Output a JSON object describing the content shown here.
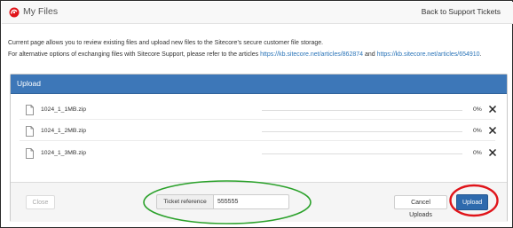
{
  "header": {
    "title": "My Files",
    "back_link": "Back to Support Tickets",
    "logo_icon": "sitecore-logo-icon"
  },
  "intro": {
    "line1": "Current page allows you to review existing files and upload new files to the Sitecore’s secure customer file storage.",
    "line2_prefix": "For alternative options of exchanging files with Sitecore Support, please refer to the articles",
    "link1": "https://kb.sitecore.net/articles/862874",
    "and": "and",
    "link2": "https://kb.sitecore.net/articles/654910",
    "suffix": "."
  },
  "upload_panel": {
    "title": "Upload",
    "files": [
      {
        "name": "1024_1_1MB.zip",
        "progress": 0,
        "percent_label": "0%"
      },
      {
        "name": "1024_1_2MB.zip",
        "progress": 0,
        "percent_label": "0%"
      },
      {
        "name": "1024_1_3MB.zip",
        "progress": 0,
        "percent_label": "0%"
      }
    ],
    "footer": {
      "close_label": "Close",
      "ticket_label": "Ticket reference",
      "ticket_value": "555555",
      "cancel_label": "Cancel Uploads",
      "upload_label": "Upload"
    }
  },
  "colors": {
    "panel_header": "#3d77b8",
    "link": "#2a74b8",
    "annotation_green": "#2aa12a",
    "annotation_red": "#e0141a"
  }
}
